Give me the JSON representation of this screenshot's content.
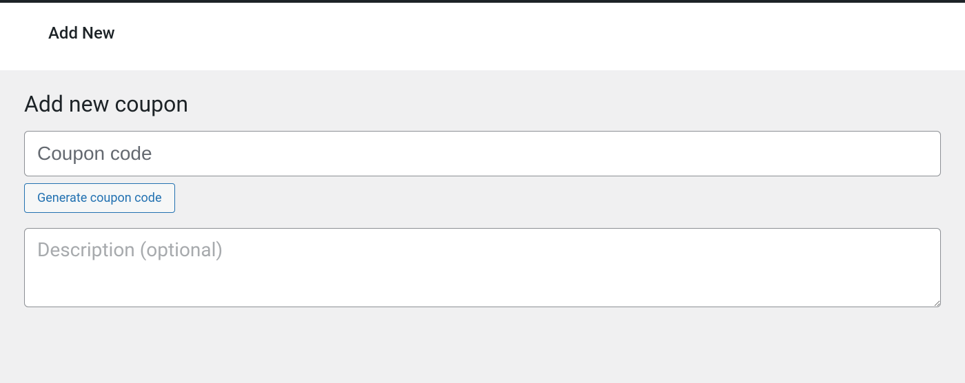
{
  "header": {
    "title": "Add New"
  },
  "page": {
    "heading": "Add new coupon"
  },
  "form": {
    "coupon_code": {
      "value": "",
      "placeholder": "Coupon code"
    },
    "generate_button_label": "Generate coupon code",
    "description": {
      "value": "",
      "placeholder": "Description (optional)"
    }
  }
}
